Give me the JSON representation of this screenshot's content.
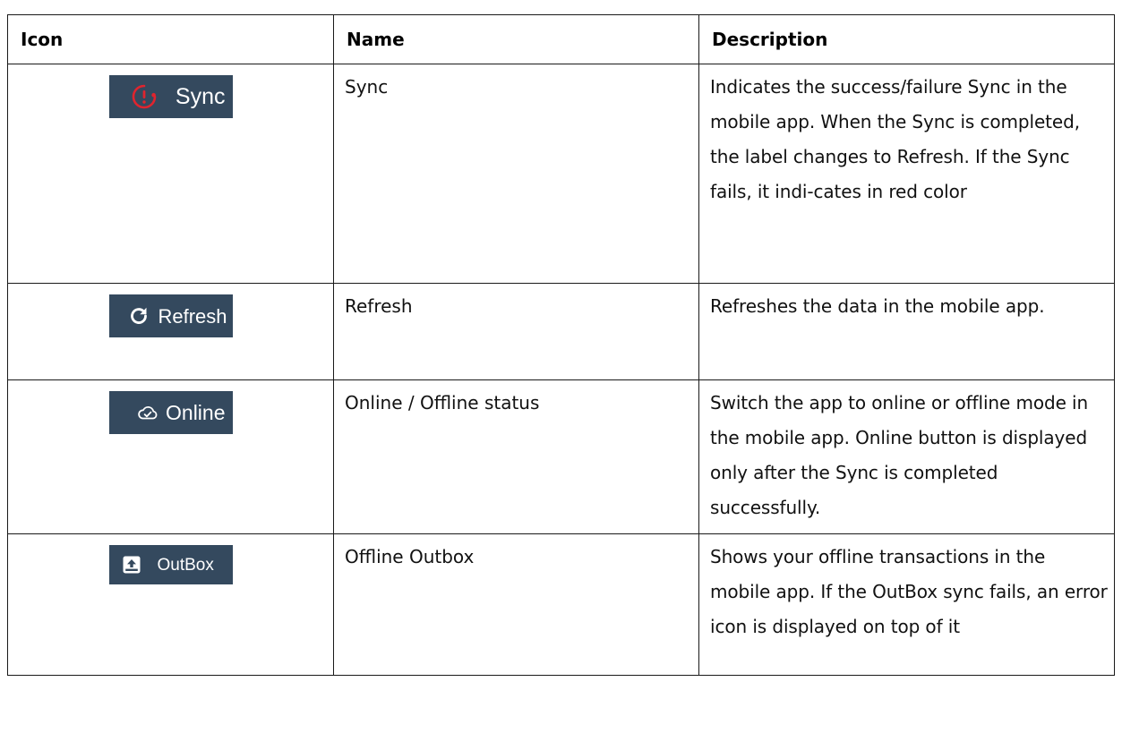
{
  "table": {
    "headers": [
      "Icon",
      "Name",
      "Description"
    ],
    "rows": [
      {
        "pill_label": "Sync",
        "icon": "sync-error-icon",
        "name": "Sync",
        "description": "Indicates the success/failure Sync in the mobile app. When the Sync is completed, the label changes to Refresh. If the Sync fails, it indi-cates in red color"
      },
      {
        "pill_label": "Refresh",
        "icon": "refresh-icon",
        "name": "Refresh",
        "description": "Refreshes the data in the mobile app."
      },
      {
        "pill_label": "Online",
        "icon": "cloud-check-icon",
        "name": "Online / Offline status",
        "description": "Switch the app to online or offline mode in the mobile app. Online button is displayed only after the Sync is completed successfully."
      },
      {
        "pill_label": "OutBox",
        "icon": "outbox-upload-icon",
        "name": "Offline Outbox",
        "description": "Shows your offline transactions in the mobile app. If the OutBox sync fails, an error icon is displayed on top of it"
      }
    ]
  },
  "colors": {
    "pill_background": "#34495e",
    "pill_text": "#ffffff",
    "error_red": "#e0242e",
    "border": "#1a1a1a"
  }
}
